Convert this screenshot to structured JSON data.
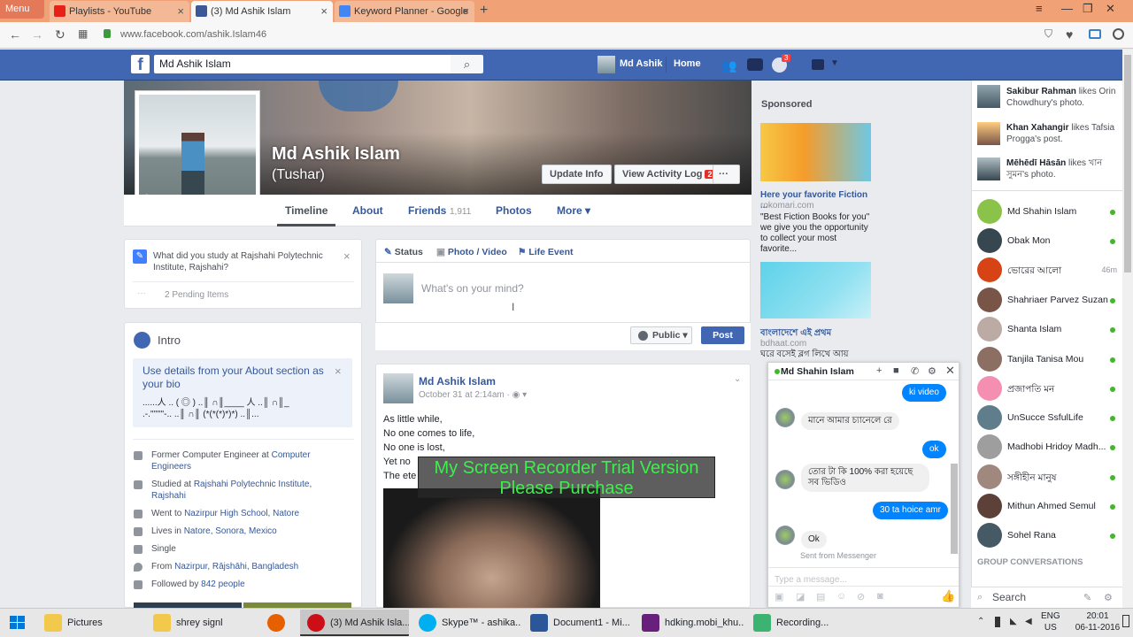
{
  "browser": {
    "menu_label": "Menu",
    "tabs": [
      {
        "label": "Playlists - YouTube",
        "color": "#e62117"
      },
      {
        "label": "(3) Md Ashik Islam",
        "color": "#3b5998"
      },
      {
        "label": "Keyword Planner - Google",
        "color": "#4285f4"
      }
    ],
    "new_tab": "+",
    "url": "www.facebook.com/ashik.Islam46"
  },
  "fb": {
    "logo": "f",
    "search_value": "Md Ashik Islam",
    "nav": {
      "user": "Md Ashik",
      "home": "Home",
      "notif_count": "3"
    },
    "profile": {
      "name": "Md Ashik Islam",
      "nickname": "(Tushar)",
      "update_info": "Update Info",
      "activity_log": "View Activity Log",
      "activity_count": "2",
      "more_dots": "···"
    },
    "tabs": {
      "timeline": "Timeline",
      "about": "About",
      "friends": "Friends",
      "friends_count": "1,911",
      "photos": "Photos",
      "more": "More ▾"
    },
    "question": {
      "text": "What did you study at Rajshahi Polytechnic Institute, Rajshahi?",
      "pending": "2 Pending Items"
    },
    "intro": {
      "title": "Intro",
      "bio_prompt": "Use details from your About section as your bio",
      "bio_sample": "......人 .. ( ◎ ) ..║ ∩║____ 人 ..║ ∩║_\n.-.''''''''-.. ..║ ∩║ (*(*(*)*)*) ..║...",
      "items": [
        {
          "pre": "Former Computer Engineer at ",
          "link": "Computer Engineers"
        },
        {
          "pre": "Studied at ",
          "link": "Rajshahi Polytechnic Institute, Rajshahi"
        },
        {
          "pre": "Went to ",
          "link": "Nazirpur High School, Natore"
        },
        {
          "pre": "Lives in ",
          "link": "Natore, Sonora, Mexico"
        },
        {
          "pre": "Single",
          "link": ""
        },
        {
          "pre": "From ",
          "link": "Nazirpur, Rājshāhi, Bangladesh"
        },
        {
          "pre": "Followed by ",
          "link": "842 people"
        }
      ]
    },
    "composer": {
      "status": "Status",
      "photo_video": "Photo / Video",
      "life_event": "Life Event",
      "placeholder": "What's on your mind?",
      "public": "Public ▾",
      "post": "Post"
    },
    "post": {
      "author": "Md Ashik Islam",
      "date": "October 31 at 2:14am · ◉ ▾",
      "lines": [
        "As little while,",
        "No one comes to life,",
        "No one is lost,",
        "Yet no",
        "The ete"
      ]
    },
    "sponsored": {
      "title": "Sponsored",
      "ad1_title": "Here your favorite Fiction ...",
      "ad1_domain": "rokomari.com",
      "ad1_body": "\"Best Fiction Books for you\" we give you the opportunity to collect your most favorite...",
      "ad2_title": "বাংলাদেশে এই প্রথম",
      "ad2_domain": "bdhaat.com",
      "ad2_body": "ঘরে বসেই ব্লগ লিখে আয়"
    },
    "chat": {
      "name": "Md Shahin Islam",
      "messages": [
        {
          "from": "me",
          "text": "ki video"
        },
        {
          "from": "them",
          "text": "মানে আমার চ্যানেলে রে"
        },
        {
          "from": "me",
          "text": "ok"
        },
        {
          "from": "them",
          "text": "তোর টা কি 100% করা হয়েছে সব ভিডিও"
        },
        {
          "from": "me",
          "text": "30 ta hoice amr"
        },
        {
          "from": "them",
          "text": "Ok"
        }
      ],
      "sent_from": "Sent from Messenger",
      "input_placeholder": "Type a message..."
    },
    "ticker": [
      {
        "name": "Sakibur Rahman",
        "rest": " likes Orin Chowdhury's photo."
      },
      {
        "name": "Khan Xahangir",
        "rest": " likes Tafsia Progga's post."
      },
      {
        "name": "Mēhēdī Hāsān",
        "rest": " likes খান সুমন's photo."
      }
    ],
    "contacts": [
      {
        "name": "Md Shahin Islam",
        "status": "online",
        "color": "#8bc34a"
      },
      {
        "name": "Obak Mon",
        "status": "online",
        "color": "#37474f"
      },
      {
        "name": "ভোরের আলো",
        "status": "46m",
        "color": "#d84315"
      },
      {
        "name": "Shahriaer Parvez Suzan",
        "status": "online",
        "color": "#795548"
      },
      {
        "name": "Shanta Islam",
        "status": "online",
        "color": "#bcaaa4"
      },
      {
        "name": "Tanjila Tanisa Mou",
        "status": "online",
        "color": "#8d6e63"
      },
      {
        "name": "প্রজাপতি মন",
        "status": "online",
        "color": "#f48fb1"
      },
      {
        "name": "UnSucce SsfulLife",
        "status": "online",
        "color": "#607d8b"
      },
      {
        "name": "Madhobi Hridoy Madh...",
        "status": "online",
        "color": "#9e9e9e"
      },
      {
        "name": "সঙ্গীহীন মানুষ",
        "status": "online",
        "color": "#a1887f"
      },
      {
        "name": "Mithun Ahmed Semul",
        "status": "online",
        "color": "#5d4037"
      },
      {
        "name": "Sohel Rana",
        "status": "online",
        "color": "#455a64"
      }
    ],
    "group_conversations": "GROUP CONVERSATIONS",
    "sidebar_search": "Search"
  },
  "watermark": {
    "line1": "My Screen Recorder Trial Version",
    "line2": "Please Purchase"
  },
  "taskbar": {
    "items": [
      {
        "label": "Pictures",
        "color": "#f2c94c"
      },
      {
        "label": "shrey signl",
        "color": "#f2c94c"
      },
      {
        "label": "",
        "color": "#e66000"
      },
      {
        "label": "(3) Md Ashik Isla...",
        "color": "#cc0f16"
      },
      {
        "label": "Skype™ - ashika...",
        "color": "#00aff0"
      },
      {
        "label": "Document1 - Mi...",
        "color": "#2b579a"
      },
      {
        "label": "hdking.mobi_khu...",
        "color": "#68217a"
      },
      {
        "label": "Recording...",
        "color": "#3cb371"
      }
    ],
    "lang": "ENG",
    "region": "US",
    "time": "20:01",
    "date": "06-11-2016"
  }
}
